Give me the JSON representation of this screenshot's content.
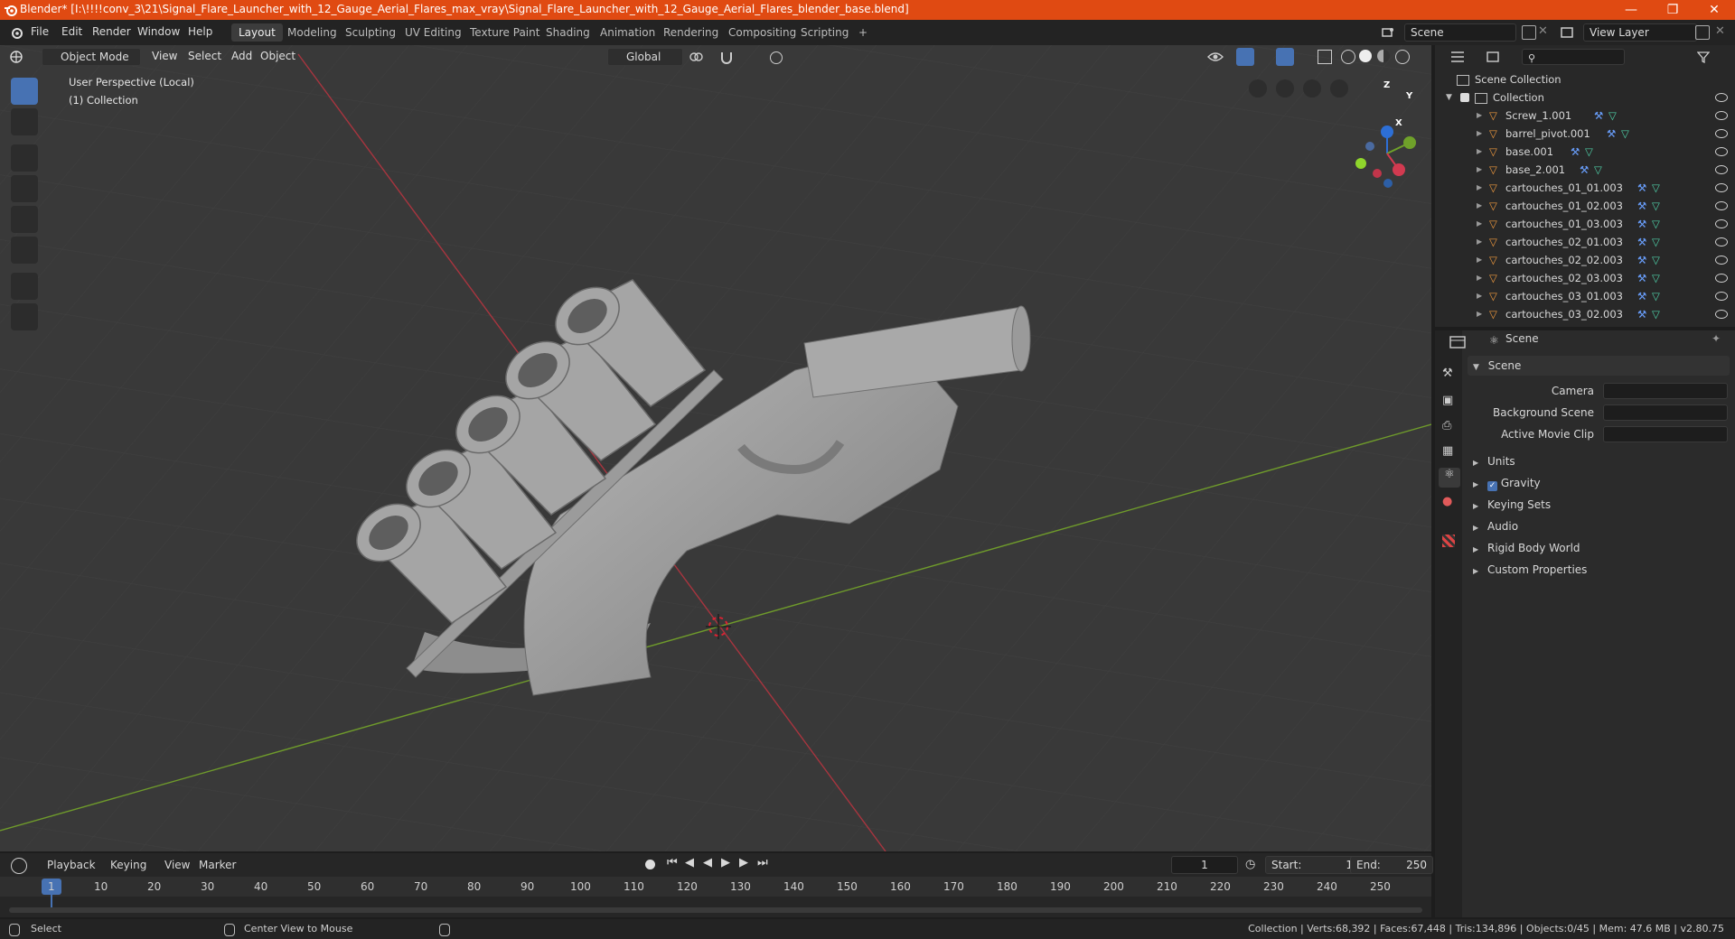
{
  "window": {
    "title": "Blender* [I:\\!!!!conv_3\\21\\Signal_Flare_Launcher_with_12_Gauge_Aerial_Flares_max_vray\\Signal_Flare_Launcher_with_12_Gauge_Aerial_Flares_blender_base.blend]",
    "accent": "#e04a12"
  },
  "topbar": {
    "menus": [
      "File",
      "Edit",
      "Render",
      "Window",
      "Help"
    ],
    "workspaces": [
      "Layout",
      "Modeling",
      "Sculpting",
      "UV Editing",
      "Texture Paint",
      "Shading",
      "Animation",
      "Rendering",
      "Compositing",
      "Scripting"
    ],
    "active_workspace": "Layout",
    "add_tab": "+",
    "scene": "Scene",
    "view_layer": "View Layer"
  },
  "viewport": {
    "mode": "Object Mode",
    "menus": [
      "View",
      "Select",
      "Add",
      "Object"
    ],
    "transform": "Global",
    "overlay_line1": "User Perspective (Local)",
    "overlay_line2": "(1) Collection",
    "gizmo_axes": [
      "Z",
      "Y",
      "X"
    ]
  },
  "outliner": {
    "root": "Scene Collection",
    "collection": "Collection",
    "items": [
      "Screw_1.001",
      "barrel_pivot.001",
      "base.001",
      "base_2.001",
      "cartouches_01_01.003",
      "cartouches_01_02.003",
      "cartouches_01_03.003",
      "cartouches_02_01.003",
      "cartouches_02_02.003",
      "cartouches_02_03.003",
      "cartouches_03_01.003",
      "cartouches_03_02.003"
    ]
  },
  "properties": {
    "header": "Scene",
    "section": "Scene",
    "fields": [
      {
        "label": "Camera"
      },
      {
        "label": "Background Scene"
      },
      {
        "label": "Active Movie Clip"
      }
    ],
    "subsections": [
      "Units",
      "Gravity",
      "Keying Sets",
      "Audio",
      "Rigid Body World",
      "Custom Properties"
    ],
    "gravity_checked": true
  },
  "timeline": {
    "menus": [
      "Playback",
      "Keying",
      "View",
      "Marker"
    ],
    "current_frame": "1",
    "start_label": "Start:",
    "start": "1",
    "end_label": "End:",
    "end": "250",
    "ticks": [
      "1",
      "10",
      "20",
      "30",
      "40",
      "50",
      "60",
      "70",
      "80",
      "90",
      "100",
      "110",
      "120",
      "130",
      "140",
      "150",
      "160",
      "170",
      "180",
      "190",
      "200",
      "210",
      "220",
      "230",
      "240",
      "250"
    ]
  },
  "statusbar": {
    "left": "Select",
    "middle": "Center View to Mouse",
    "right": "Collection | Verts:68,392 | Faces:67,448 | Tris:134,896 | Objects:0/45 | Mem: 47.6 MB | v2.80.75"
  }
}
